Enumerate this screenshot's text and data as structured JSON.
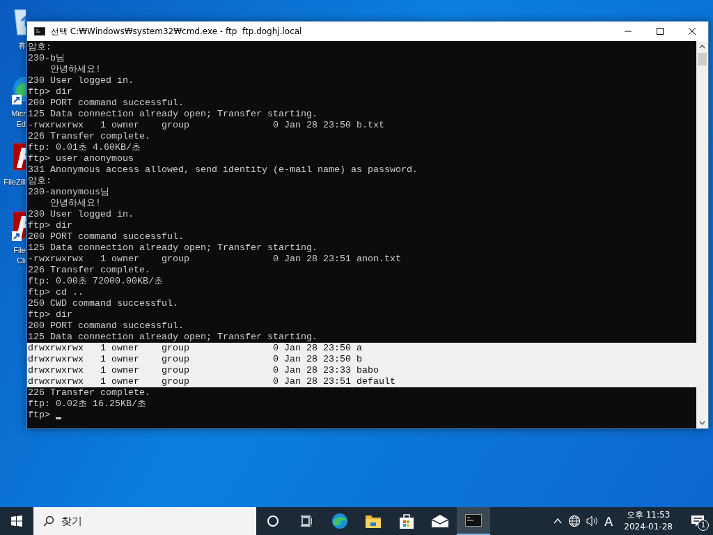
{
  "desktop_icons": [
    {
      "kind": "recycle-bin",
      "shortcut": false,
      "label_lines": [
        "휴"
      ]
    },
    {
      "kind": "edge",
      "shortcut": true,
      "label_lines": [
        "Micr",
        "Ed"
      ]
    },
    {
      "kind": "filezilla",
      "shortcut": false,
      "label_lines": [
        "FileZill"
      ]
    },
    {
      "kind": "filezilla",
      "shortcut": true,
      "label_lines": [
        "File",
        "Cli"
      ]
    }
  ],
  "window": {
    "title": "선택 C:₩Windows₩system32₩cmd.exe - ftp  ftp.doghj.local",
    "lines": [
      {
        "text": "암호:",
        "selected": false
      },
      {
        "text": "230-b님",
        "selected": false
      },
      {
        "text": "    안녕하세요!",
        "selected": false
      },
      {
        "text": "230 User logged in.",
        "selected": false
      },
      {
        "text": "ftp> dir",
        "selected": false
      },
      {
        "text": "200 PORT command successful.",
        "selected": false
      },
      {
        "text": "125 Data connection already open; Transfer starting.",
        "selected": false
      },
      {
        "text": "-rwxrwxrwx   1 owner    group               0 Jan 28 23:50 b.txt",
        "selected": false
      },
      {
        "text": "226 Transfer complete.",
        "selected": false
      },
      {
        "text": "ftp: 0.01초 4.60KB/초",
        "selected": false
      },
      {
        "text": "ftp> user anonymous",
        "selected": false
      },
      {
        "text": "331 Anonymous access allowed, send identity (e-mail name) as password.",
        "selected": false
      },
      {
        "text": "암호:",
        "selected": false
      },
      {
        "text": "230-anonymous님",
        "selected": false
      },
      {
        "text": "    안녕하세요!",
        "selected": false
      },
      {
        "text": "230 User logged in.",
        "selected": false
      },
      {
        "text": "ftp> dir",
        "selected": false
      },
      {
        "text": "200 PORT command successful.",
        "selected": false
      },
      {
        "text": "125 Data connection already open; Transfer starting.",
        "selected": false
      },
      {
        "text": "-rwxrwxrwx   1 owner    group               0 Jan 28 23:51 anon.txt",
        "selected": false
      },
      {
        "text": "226 Transfer complete.",
        "selected": false
      },
      {
        "text": "ftp: 0.00초 72000.00KB/초",
        "selected": false
      },
      {
        "text": "ftp> cd ..",
        "selected": false
      },
      {
        "text": "250 CWD command successful.",
        "selected": false
      },
      {
        "text": "ftp> dir",
        "selected": false
      },
      {
        "text": "200 PORT command successful.",
        "selected": false
      },
      {
        "text": "125 Data connection already open; Transfer starting.",
        "selected": false
      },
      {
        "text": "drwxrwxrwx   1 owner    group               0 Jan 28 23:50 a",
        "selected": true
      },
      {
        "text": "drwxrwxrwx   1 owner    group               0 Jan 28 23:50 b",
        "selected": true
      },
      {
        "text": "drwxrwxrwx   1 owner    group               0 Jan 28 23:33 babo",
        "selected": true
      },
      {
        "text": "drwxrwxrwx   1 owner    group               0 Jan 28 23:51 default",
        "selected": true
      },
      {
        "text": "226 Transfer complete.",
        "selected": false
      },
      {
        "text": "ftp: 0.02초 16.25KB/초",
        "selected": false
      }
    ],
    "prompt": "ftp> "
  },
  "taskbar": {
    "search": {
      "placeholder": "찾기"
    },
    "apps": [
      {
        "kind": "cortana",
        "active": false
      },
      {
        "kind": "task-view",
        "active": false
      },
      {
        "kind": "edge",
        "active": false
      },
      {
        "kind": "folder",
        "active": false
      },
      {
        "kind": "store",
        "active": false
      },
      {
        "kind": "mail",
        "active": false
      },
      {
        "kind": "console",
        "active": true
      }
    ],
    "ime": "A",
    "time": "오후 11:53",
    "date": "2024-01-28",
    "notifications": "1"
  }
}
